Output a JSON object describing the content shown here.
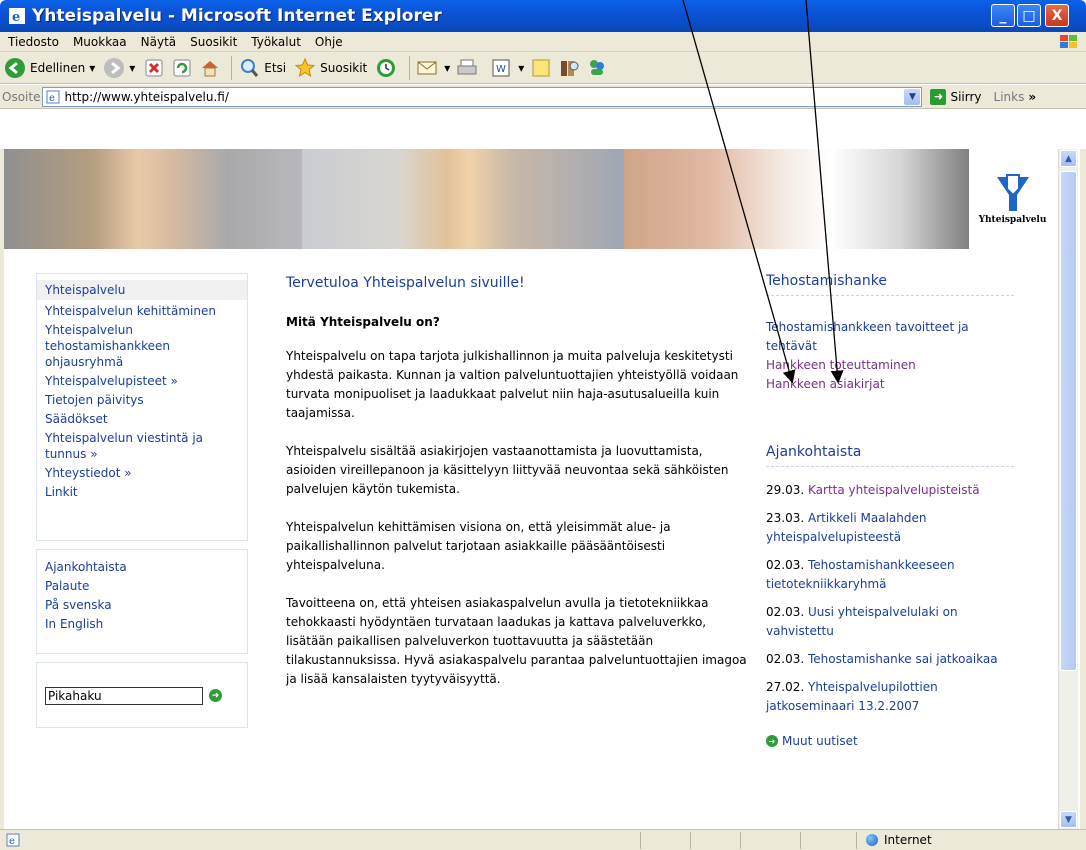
{
  "window": {
    "title": "Yhteispalvelu - Microsoft Internet Explorer",
    "min": "_",
    "max": "□",
    "close": "X"
  },
  "menu": {
    "items": [
      "Tiedosto",
      "Muokkaa",
      "Näytä",
      "Suosikit",
      "Työkalut",
      "Ohje"
    ]
  },
  "toolbar": {
    "back_label": "Edellinen",
    "search_label": "Etsi",
    "favorites_label": "Suosikit"
  },
  "address": {
    "label": "Osoite",
    "url": "http://www.yhteispalvelu.fi/",
    "go_label": "Siirry",
    "links_label": "Links",
    "links_chevron": "»"
  },
  "logo": {
    "text": "Yhteispalvelu"
  },
  "nav": {
    "primary": [
      "Yhteispalvelu",
      "Yhteispalvelun kehittäminen",
      "Yhteispalvelun tehostamishankkeen ohjausryhmä",
      "Yhteispalvelupisteet »",
      "Tietojen päivitys",
      "Säädökset",
      "Yhteispalvelun viestintä ja tunnus »",
      "Yhteystiedot »",
      "Linkit"
    ],
    "secondary": [
      "Ajankohtaista",
      "Palaute",
      "På svenska",
      "In English"
    ],
    "search_value": "Pikahaku"
  },
  "main": {
    "title": "Tervetuloa Yhteispalvelun sivuille!",
    "subtitle": "Mitä Yhteispalvelu on?",
    "paragraphs": [
      "Yhteispalvelu on tapa tarjota julkishallinnon ja muita palveluja keskitetysti yhdestä paikasta. Kunnan ja valtion palveluntuottajien yhteistyöllä voidaan turvata monipuoliset ja laadukkaat palvelut niin haja-asutusalueilla kuin taajamissa.",
      "Yhteispalvelu sisältää asiakirjojen vastaanottamista ja luovuttamista, asioiden vireillepanoon ja käsittelyyn liittyvää neuvontaa sekä sähköisten palvelujen käytön tukemista.",
      "Yhteispalvelun kehittämisen visiona on, että yleisimmät alue- ja paikallishallinnon palvelut tarjotaan asiakkaille pääsääntöisesti yhteispalveluna.",
      "Tavoitteena on, että yhteisen asiakaspalvelun avulla ja tietotekniikkaa tehokkaasti hyödyntäen turvataan laadukas ja kattava palveluverkko, lisätään paikallisen palveluverkon tuottavuutta ja säästetään tilakustannuksissa. Hyvä asiakaspalvelu parantaa palveluntuottajien imagoa ja lisää kansalaisten tyytyväisyyttä."
    ]
  },
  "right": {
    "tehostamis_heading": "Tehostamishanke",
    "tehostamis_links": [
      "Tehostamishankkeen tavoitteet ja tehtävät",
      "Hankkeen toteuttaminen",
      "Hankkeen asiakirjat"
    ],
    "ajank_heading": "Ajankohtaista",
    "news": [
      {
        "date": "29.03.",
        "text": "Kartta yhteispalvelupisteistä"
      },
      {
        "date": "23.03.",
        "text": "Artikkeli Maalahden yhteispalvelupisteestä"
      },
      {
        "date": "02.03.",
        "text": "Tehostamishankkeeseen tietotekniikkaryhmä"
      },
      {
        "date": "02.03.",
        "text": "Uusi yhteispalvelulaki on vahvistettu"
      },
      {
        "date": "02.03.",
        "text": "Tehostamishanke sai jatkoaikaa"
      },
      {
        "date": "27.02.",
        "text": "Yhteispalvelupilottien jatkoseminaari 13.2.2007"
      }
    ],
    "more_news": "Muut uutiset"
  },
  "status": {
    "zone": "Internet"
  },
  "colors": {
    "link": "#1a3e9a",
    "visited": "#7a2f8b",
    "titlebar": "#0a56d8",
    "chrome": "#ece9d8"
  }
}
